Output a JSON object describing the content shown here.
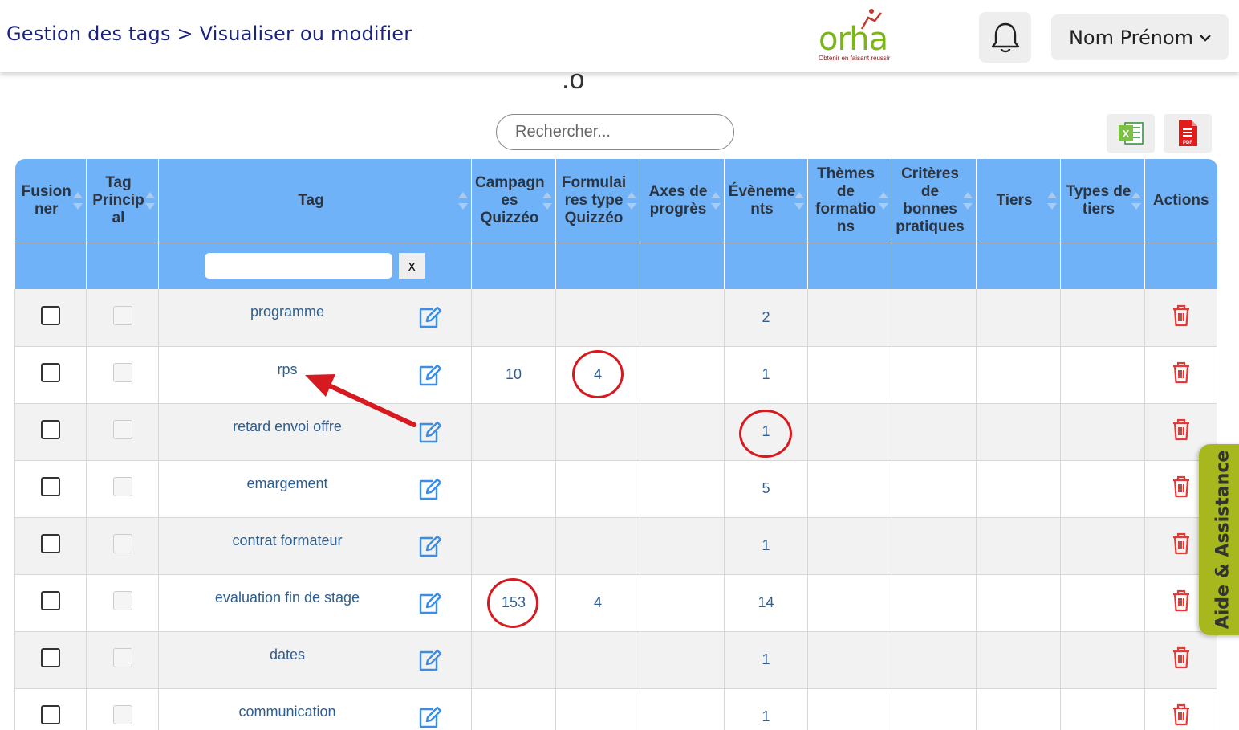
{
  "header": {
    "breadcrumb": "Gestion des tags > Visualiser ou modifier",
    "logo_text": "orha",
    "logo_tagline": "Obtenir en faisant réussir",
    "user_name": "Nom Prénom"
  },
  "page": {
    "partial_char": ".o"
  },
  "search": {
    "placeholder": "Rechercher..."
  },
  "exports": {
    "excel_icon": "excel-icon",
    "pdf_icon": "pdf-icon",
    "pdf_label": "PDF",
    "excel_label": "X"
  },
  "table": {
    "columns": {
      "fusionner": "Fusion ner",
      "tag_principal": "Tag Princip al",
      "tag": "Tag",
      "campagnes": "Campagn es Quizzéo",
      "formulaires": "Formulai res type Quizzéo",
      "axes": "Axes de progrès",
      "evenements": "Évèneme nts",
      "themes": "Thèmes de formatio ns",
      "criteres": "Critères de bonnes pratiques",
      "tiers": "Tiers",
      "types_tiers": "Types de tiers",
      "actions": "Actions"
    },
    "filter_clear": "x",
    "rows": [
      {
        "tag": "programme",
        "campagnes": "",
        "formulaires": "",
        "evenements": "2"
      },
      {
        "tag": "rps",
        "campagnes": "10",
        "formulaires": "4",
        "evenements": "1"
      },
      {
        "tag": "retard envoi offre",
        "campagnes": "",
        "formulaires": "",
        "evenements": "1"
      },
      {
        "tag": "emargement",
        "campagnes": "",
        "formulaires": "",
        "evenements": "5"
      },
      {
        "tag": "contrat formateur",
        "campagnes": "",
        "formulaires": "",
        "evenements": "1"
      },
      {
        "tag": "evaluation fin de stage",
        "campagnes": "153",
        "formulaires": "4",
        "evenements": "14"
      },
      {
        "tag": "dates",
        "campagnes": "",
        "formulaires": "",
        "evenements": "1"
      },
      {
        "tag": "communication",
        "campagnes": "",
        "formulaires": "",
        "evenements": "1"
      }
    ]
  },
  "help": {
    "label": "Aide & Assistance"
  },
  "colors": {
    "header_blue": "#6fb2f7",
    "annotation_red": "#d71920",
    "help_green": "#a6b81e",
    "breadcrumb": "#1a237e"
  }
}
